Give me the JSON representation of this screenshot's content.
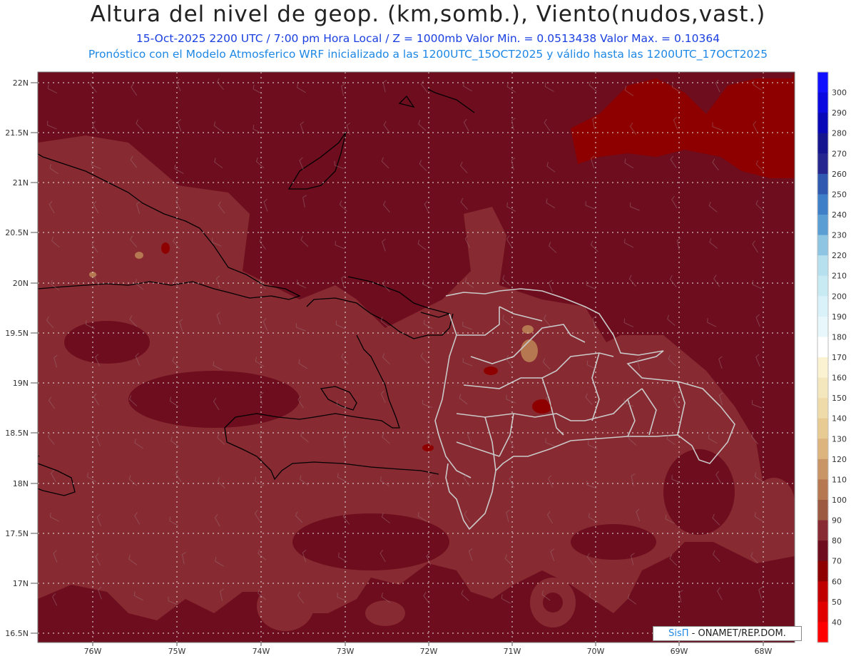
{
  "header": {
    "title": "Altura del nivel de geop. (km,somb.), Viento(nudos,vast.)",
    "subtitle_line1": "15-Oct-2025  2200 UTC / 7:00 pm Hora Local / Z = 1000mb  Valor Min. = 0.0513438  Valor Max. = 0.10364",
    "subtitle_line2": "Pronóstico con el Modelo Atmosferico WRF inicializado a las 1200UTC_15OCT2025 y válido hasta las  1200UTC_17OCT2025"
  },
  "axes": {
    "lat_labels": [
      "22N",
      "21.5N",
      "21N",
      "20.5N",
      "20N",
      "19.5N",
      "19N",
      "18.5N",
      "18N",
      "17.5N",
      "17N",
      "16.5N"
    ],
    "lon_labels": [
      "76W",
      "75W",
      "74W",
      "73W",
      "72W",
      "71W",
      "70W",
      "69W",
      "68W"
    ]
  },
  "colorbar": {
    "labels": [
      "300",
      "290",
      "280",
      "270",
      "260",
      "250",
      "240",
      "230",
      "220",
      "210",
      "200",
      "190",
      "180",
      "170",
      "160",
      "150",
      "140",
      "130",
      "120",
      "110",
      "100",
      "90",
      "80",
      "70",
      "60",
      "50",
      "40"
    ],
    "colors": [
      "#1010ff",
      "#0a0ae0",
      "#0808b8",
      "#151590",
      "#262690",
      "#2f58b0",
      "#3f7fc7",
      "#5a9ed4",
      "#8dc5e3",
      "#b7e0ee",
      "#c7eaf3",
      "#d9f1f8",
      "#e8f7fb",
      "#ffffff",
      "#fbf2d2",
      "#f4e6bd",
      "#efdaaa",
      "#e8cb92",
      "#ddb47e",
      "#c99566",
      "#b67850",
      "#9c5a40",
      "#882a32",
      "#6d0d1e",
      "#8e0000",
      "#c00000",
      "#e10000",
      "#ff0000"
    ]
  },
  "credit": {
    "brand": "SisΠ",
    "text": " - ONAMET/REP.DOM."
  }
}
